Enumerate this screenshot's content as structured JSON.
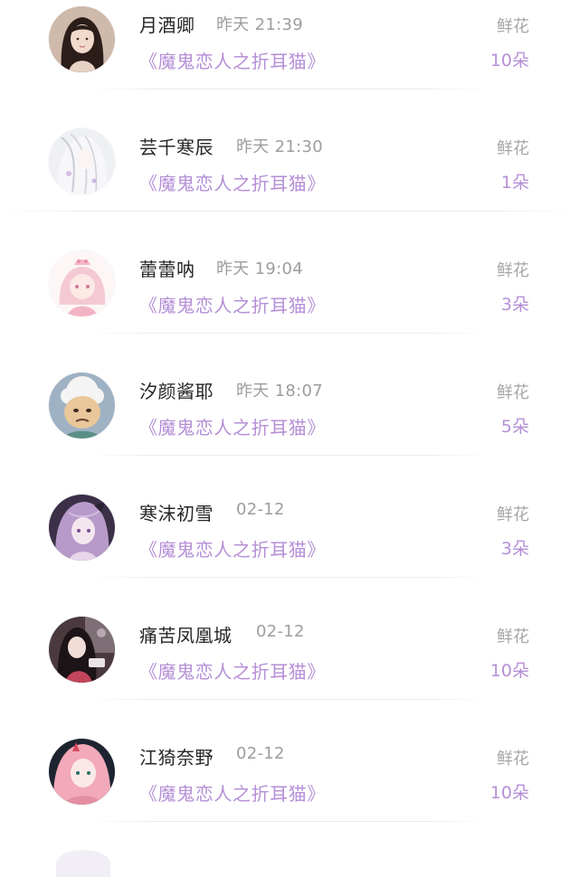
{
  "entries": [
    {
      "name": "月酒卿",
      "time": "昨天 21:39",
      "book": "《魔鬼恋人之折耳猫》",
      "gift_label": "鲜花",
      "gift_count": "10朵",
      "avatar": "avatar-woman-icon"
    },
    {
      "name": "芸千寒辰",
      "time": "昨天 21:30",
      "book": "《魔鬼恋人之折耳猫》",
      "gift_label": "鲜花",
      "gift_count": "1朵",
      "avatar": "avatar-white-hair-icon"
    },
    {
      "name": "蕾蕾呐",
      "time": "昨天 19:04",
      "book": "《魔鬼恋人之折耳猫》",
      "gift_label": "鲜花",
      "gift_count": "3朵",
      "avatar": "avatar-pink-anime-icon"
    },
    {
      "name": "汐颜酱耶",
      "time": "昨天 18:07",
      "book": "《魔鬼恋人之折耳猫》",
      "gift_label": "鲜花",
      "gift_count": "5朵",
      "avatar": "avatar-sheep-cartoon-icon"
    },
    {
      "name": "寒沫初雪",
      "time": "02-12",
      "book": "《魔鬼恋人之折耳猫》",
      "gift_label": "鲜花",
      "gift_count": "3朵",
      "avatar": "avatar-purple-anime-icon"
    },
    {
      "name": "痛苦凤凰城",
      "time": "02-12",
      "book": "《魔鬼恋人之折耳猫》",
      "gift_label": "鲜花",
      "gift_count": "10朵",
      "avatar": "avatar-dark-hair-icon"
    },
    {
      "name": "江猗奈野",
      "time": "02-12",
      "book": "《魔鬼恋人之折耳猫》",
      "gift_label": "鲜花",
      "gift_count": "10朵",
      "avatar": "avatar-pink-hair-icon"
    }
  ],
  "colors": {
    "accent": "#b58fd6",
    "name_text": "#262626",
    "meta_text": "#9d9d9d"
  }
}
